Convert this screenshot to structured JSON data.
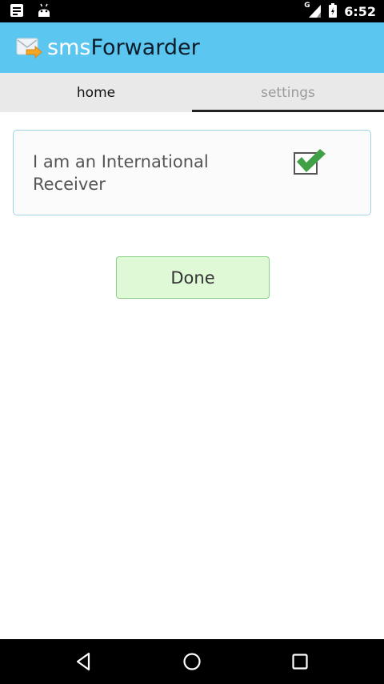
{
  "status_bar": {
    "time": "6:52",
    "network_label": "G",
    "left_icons": [
      "notes-icon",
      "android-icon"
    ],
    "right_icons": [
      "signal-icon",
      "battery-icon"
    ]
  },
  "app_bar": {
    "title_part1": "sms",
    "title_part2": "Forwarder",
    "logo_icon": "envelope-forward-icon",
    "color": "#5bc6ef"
  },
  "tabs": [
    {
      "label": "home",
      "selected": false
    },
    {
      "label": "settings",
      "selected": true
    }
  ],
  "card": {
    "label": "I am an International Receiver",
    "checked": true,
    "check_color": "#3fa046"
  },
  "done_button": {
    "label": "Done",
    "color": "#dff9d7"
  },
  "nav_bar": {
    "icons": [
      "back-icon",
      "home-icon",
      "recents-icon"
    ]
  }
}
